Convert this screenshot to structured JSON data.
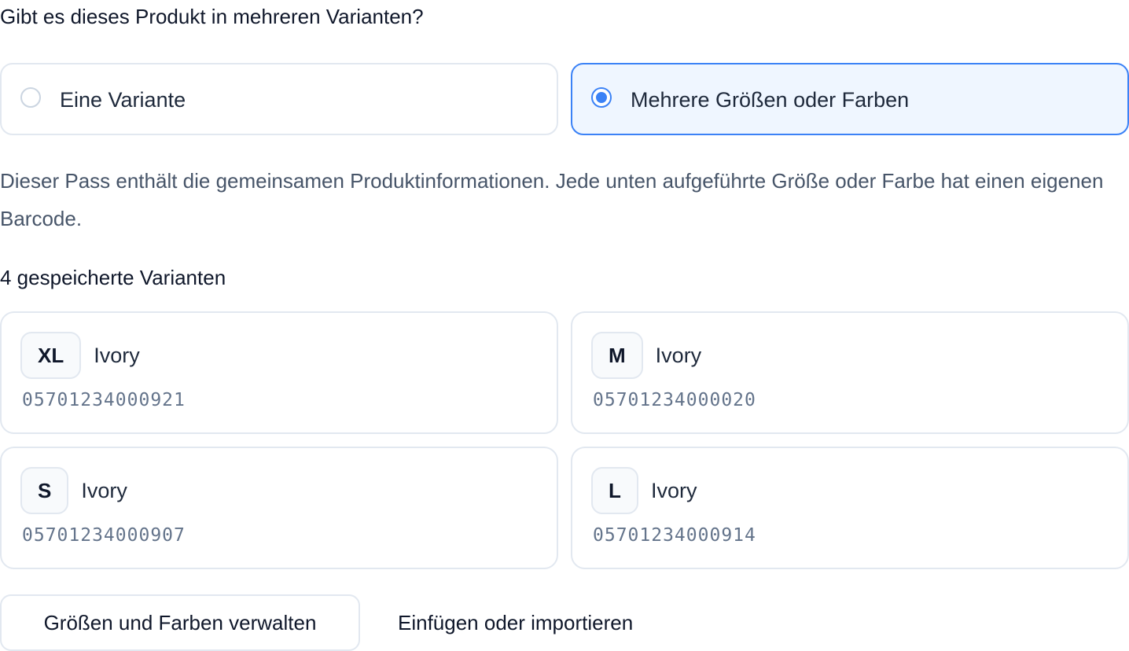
{
  "question": "Gibt es dieses Produkt in mehreren Varianten?",
  "options": [
    {
      "label": "Eine Variante",
      "selected": false
    },
    {
      "label": "Mehrere Größen oder Farben",
      "selected": true
    }
  ],
  "description": "Dieser Pass enthält die gemeinsamen Produktinformationen. Jede unten aufgeführte Größe oder Farbe hat einen eigenen Barcode.",
  "variants_heading": "4 gespeicherte Varianten",
  "variants": [
    {
      "size": "XL",
      "color": "Ivory",
      "barcode": "05701234000921"
    },
    {
      "size": "M",
      "color": "Ivory",
      "barcode": "05701234000020"
    },
    {
      "size": "S",
      "color": "Ivory",
      "barcode": "05701234000907"
    },
    {
      "size": "L",
      "color": "Ivory",
      "barcode": "05701234000914"
    }
  ],
  "actions": {
    "manage_label": "Größen und Farben verwalten",
    "import_label": "Einfügen oder importieren"
  },
  "colors": {
    "accent": "#3b82f6",
    "selected_bg": "#eff6ff",
    "border": "#e2e8f0",
    "muted_text": "#475569"
  }
}
